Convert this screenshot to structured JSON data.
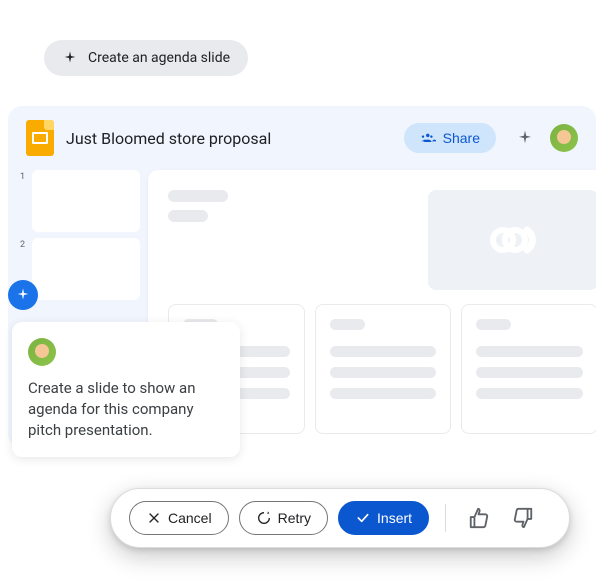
{
  "suggestion": {
    "label": "Create an agenda slide"
  },
  "document": {
    "title": "Just Bloomed store proposal"
  },
  "header": {
    "share_label": "Share"
  },
  "thumbnails": [
    {
      "number": "1"
    },
    {
      "number": "2"
    }
  ],
  "prompt": {
    "text": "Create a slide to show an agenda for this company pitch presentation."
  },
  "actions": {
    "cancel_label": "Cancel",
    "retry_label": "Retry",
    "insert_label": "Insert"
  }
}
